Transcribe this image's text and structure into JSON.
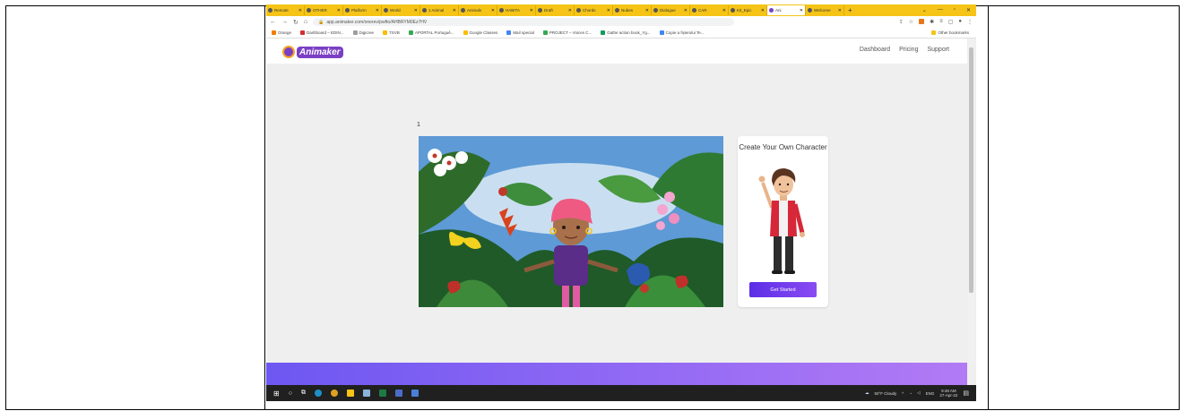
{
  "tabs": [
    {
      "label": "Remote"
    },
    {
      "label": "OTHER"
    },
    {
      "label": "Platform"
    },
    {
      "label": "World"
    },
    {
      "label": "1 Animal"
    },
    {
      "label": "Animals"
    },
    {
      "label": "HABITA"
    },
    {
      "label": "Draft"
    },
    {
      "label": "Chords"
    },
    {
      "label": "Nubes"
    },
    {
      "label": "Dialogue"
    },
    {
      "label": "CAR"
    },
    {
      "label": "Kit_Epic"
    },
    {
      "label": "Ani"
    },
    {
      "label": "Welcome"
    }
  ],
  "browser": {
    "url": "app.animaker.com/onerev/pwfto/AHBRYM0Ez7HV",
    "other_bookmarks": "Other bookmarks"
  },
  "bookmarks": [
    {
      "label": "Orange",
      "color": "#f57c00"
    },
    {
      "label": "Dashboard – EDIN...",
      "color": "#d32f2f"
    },
    {
      "label": "Digicree",
      "color": "#9e9e9e"
    },
    {
      "label": "TSVB",
      "color": "#fbbc04"
    },
    {
      "label": "APORTAL  Portuguê...",
      "color": "#34a853"
    },
    {
      "label": "Google Classes",
      "color": "#fbbc04"
    },
    {
      "label": "Mail special",
      "color": "#4285f4"
    },
    {
      "label": "PROJECT – Voices C...",
      "color": "#34a853"
    },
    {
      "label": "Gathe action book_Yg...",
      "color": "#0f9d58"
    },
    {
      "label": "Copie a fișierului Te...",
      "color": "#4285f4"
    }
  ],
  "app": {
    "logo_text": "Animaker",
    "nav": [
      "Dashboard",
      "Pricing",
      "Support"
    ]
  },
  "main": {
    "slide_number": "1",
    "promo_title": "Create Your Own Character",
    "cta_label": "Get Started"
  },
  "taskbar": {
    "weather": "50°F Cloudy",
    "lang": "ENG",
    "time": "9:48 AM",
    "date": "27-Apr-22"
  },
  "colors": {
    "tab_strip": "#f5c417",
    "accent": "#5b2ee6",
    "footer_start": "#6d57f2",
    "footer_end": "#b27af5"
  }
}
